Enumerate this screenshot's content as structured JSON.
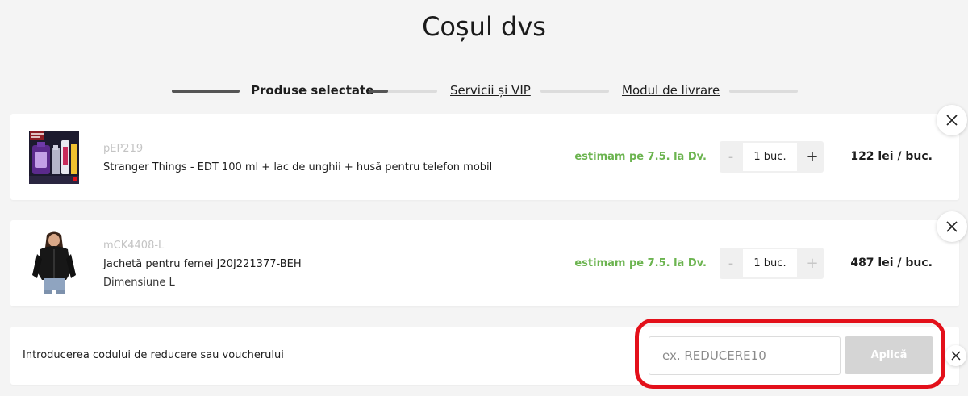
{
  "title": "Coșul dvs",
  "steps": [
    {
      "label": "Produse selectate",
      "state": "current"
    },
    {
      "label": "Servicii și VIP",
      "state": "link"
    },
    {
      "label": "Modul de livrare",
      "state": "link"
    }
  ],
  "items": [
    {
      "code": "pEP219",
      "name": "Stranger Things - EDT 100 ml + lac de unghii + husă pentru telefon mobil",
      "variant": "",
      "delivery": "estimam pe 7.5. la Dv.",
      "quantity": "1 buc.",
      "price": "122 lei / buc.",
      "image_icon": "perfume-gift-set-image"
    },
    {
      "code": "mCK4408-L",
      "name": "Jachetă pentru femei J20J221377-BEH",
      "variant": "Dimensiune L",
      "delivery": "estimam pe 7.5. la Dv.",
      "quantity": "1 buc.",
      "price": "487 lei / buc.",
      "image_icon": "jacket-image"
    }
  ],
  "quantity_controls": {
    "minus": "-",
    "plus": "+"
  },
  "voucher": {
    "label": "Introducerea codului de reducere sau voucherului",
    "placeholder": "ex. REDUCERE10",
    "apply_label": "Aplică"
  },
  "colors": {
    "delivery": "#6cb450",
    "highlight": "#e3101a",
    "background": "#f4f4f4"
  }
}
